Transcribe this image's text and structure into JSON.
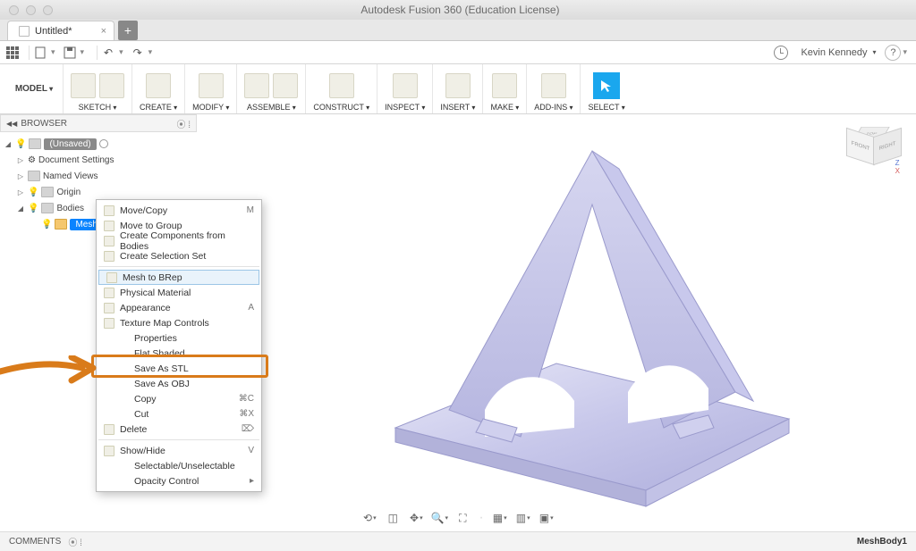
{
  "window": {
    "title": "Autodesk Fusion 360 (Education License)"
  },
  "tab": {
    "name": "Untitled*"
  },
  "qat": {
    "user": "Kevin Kennedy"
  },
  "ribbon": {
    "workspace": "MODEL",
    "groups": [
      {
        "label": "SKETCH"
      },
      {
        "label": "CREATE"
      },
      {
        "label": "MODIFY"
      },
      {
        "label": "ASSEMBLE"
      },
      {
        "label": "CONSTRUCT"
      },
      {
        "label": "INSPECT"
      },
      {
        "label": "INSERT"
      },
      {
        "label": "MAKE"
      },
      {
        "label": "ADD-INS"
      },
      {
        "label": "SELECT"
      }
    ]
  },
  "browser": {
    "title": "BROWSER",
    "root": "(Unsaved)",
    "items": {
      "docset": "Document Settings",
      "named": "Named Views",
      "origin": "Origin",
      "bodies": "Bodies",
      "meshbody": "MeshBody1"
    }
  },
  "context": {
    "items": [
      {
        "label": "Move/Copy",
        "shortcut": "M",
        "icon": true
      },
      {
        "label": "Move to Group",
        "icon": true
      },
      {
        "label": "Create Components from Bodies",
        "icon": true
      },
      {
        "label": "Create Selection Set",
        "icon": true
      },
      {
        "sep": true
      },
      {
        "label": "Mesh to BRep",
        "icon": true,
        "highlight": true
      },
      {
        "label": "Physical Material",
        "icon": true
      },
      {
        "label": "Appearance",
        "shortcut": "A",
        "icon": true
      },
      {
        "label": "Texture Map Controls",
        "icon": true
      },
      {
        "label": "Properties",
        "indent": true
      },
      {
        "label": "Flat Shaded",
        "indent": true
      },
      {
        "label": "Save As STL",
        "indent": true
      },
      {
        "label": "Save As OBJ",
        "indent": true
      },
      {
        "label": "Copy",
        "shortcut": "⌘C",
        "indent": true
      },
      {
        "label": "Cut",
        "shortcut": "⌘X",
        "indent": true
      },
      {
        "label": "Delete",
        "shortcut": "⌦",
        "icon": true
      },
      {
        "sep": true
      },
      {
        "label": "Show/Hide",
        "shortcut": "V",
        "icon": true
      },
      {
        "label": "Selectable/Unselectable",
        "indent": true
      },
      {
        "label": "Opacity Control",
        "indent": true,
        "submenu": true
      }
    ]
  },
  "status": {
    "comments": "COMMENTS",
    "selection": "MeshBody1"
  },
  "viewcube": {
    "top": "TOP",
    "front": "FRONT",
    "right": "RIGHT"
  }
}
